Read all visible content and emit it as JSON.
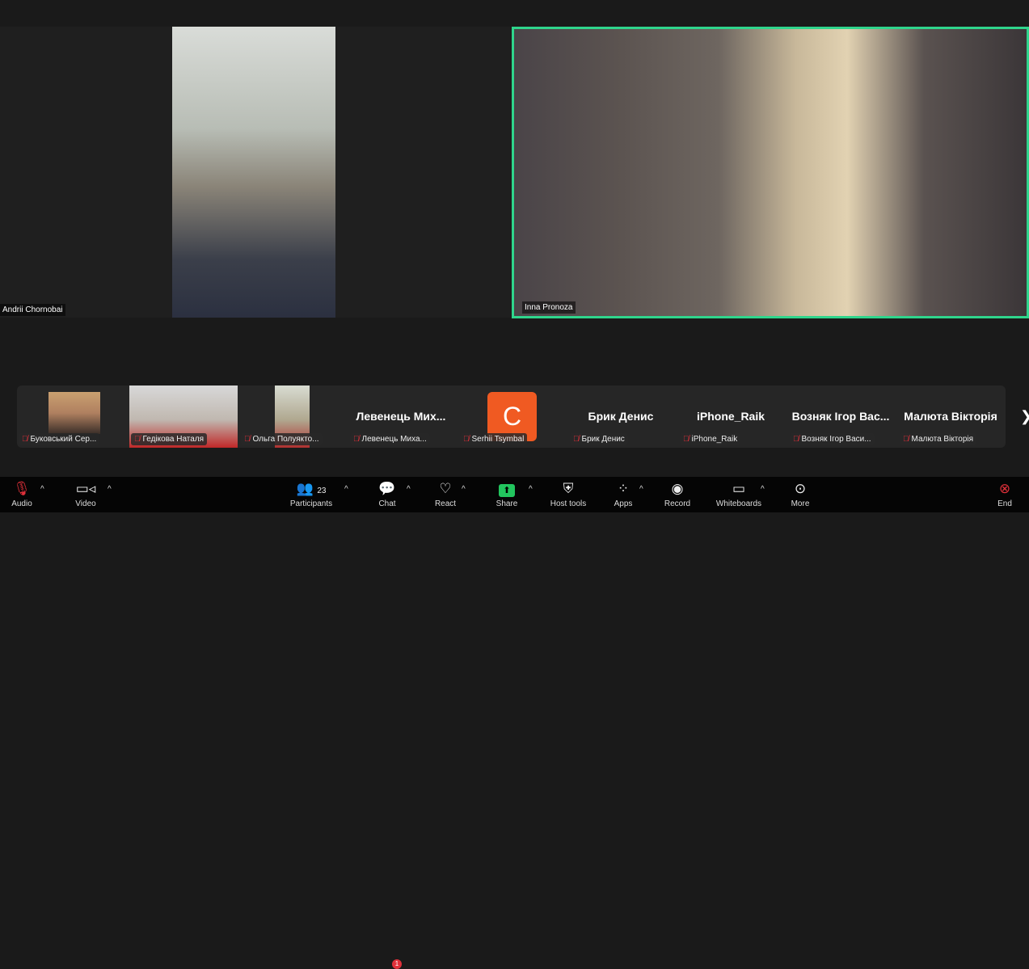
{
  "main_tiles": [
    {
      "name": "Andrii Chornobai"
    },
    {
      "name": "Inna Pronoza",
      "active_speaker": true
    }
  ],
  "accent_color": "#2fd58c",
  "thumbnails": [
    {
      "label": "Буковський Сер..."
    },
    {
      "label": "Гедікова Наталя"
    },
    {
      "label": "Ольга Полуякто..."
    },
    {
      "display": "Левенець  Мих...",
      "label": "Левенець Миха..."
    },
    {
      "avatar": "C",
      "label": "Serhii Tsymbal"
    },
    {
      "display": "Брик Денис",
      "label": "Брик Денис"
    },
    {
      "display": "iPhone_Raik",
      "label": "iPhone_Raik"
    },
    {
      "display": "Возняк Ігор Вас...",
      "label": "Возняк Ігор Васи..."
    },
    {
      "display": "Малюта Вікторія",
      "label": "Малюта Вікторія"
    }
  ],
  "toolbar": {
    "audio": "Audio",
    "video": "Video",
    "participants": "Participants",
    "participants_count": "23",
    "chat": "Chat",
    "chat_badge": "1",
    "react": "React",
    "share": "Share",
    "host_tools": "Host tools",
    "apps": "Apps",
    "record": "Record",
    "whiteboards": "Whiteboards",
    "more": "More",
    "end": "End"
  }
}
